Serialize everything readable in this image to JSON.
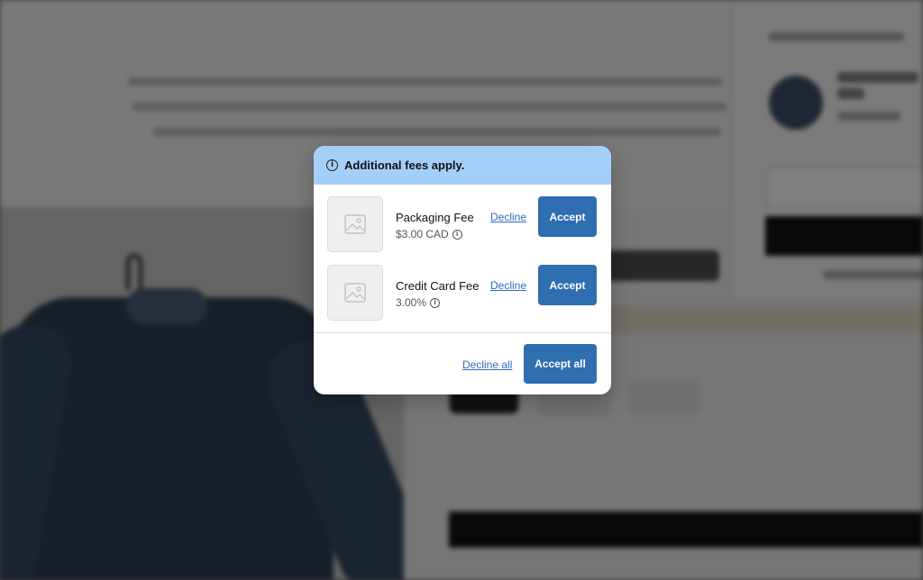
{
  "modal": {
    "title": "Additional fees apply.",
    "header_icon": "info-icon",
    "fees": [
      {
        "name": "Packaging Fee",
        "price": "$3.00 CAD",
        "decline_label": "Decline",
        "accept_label": "Accept",
        "image_icon": "image-placeholder-icon"
      },
      {
        "name": "Credit Card Fee",
        "price": "3.00%",
        "decline_label": "Decline",
        "accept_label": "Accept",
        "image_icon": "image-placeholder-icon"
      }
    ],
    "footer": {
      "decline_all_label": "Decline all",
      "accept_all_label": "Accept all"
    }
  },
  "colors": {
    "header_bg": "#a4cff8",
    "primary_button": "#2f6eb1",
    "link": "#2d6dbd",
    "overlay": "rgba(0,0,0,0.5)"
  }
}
